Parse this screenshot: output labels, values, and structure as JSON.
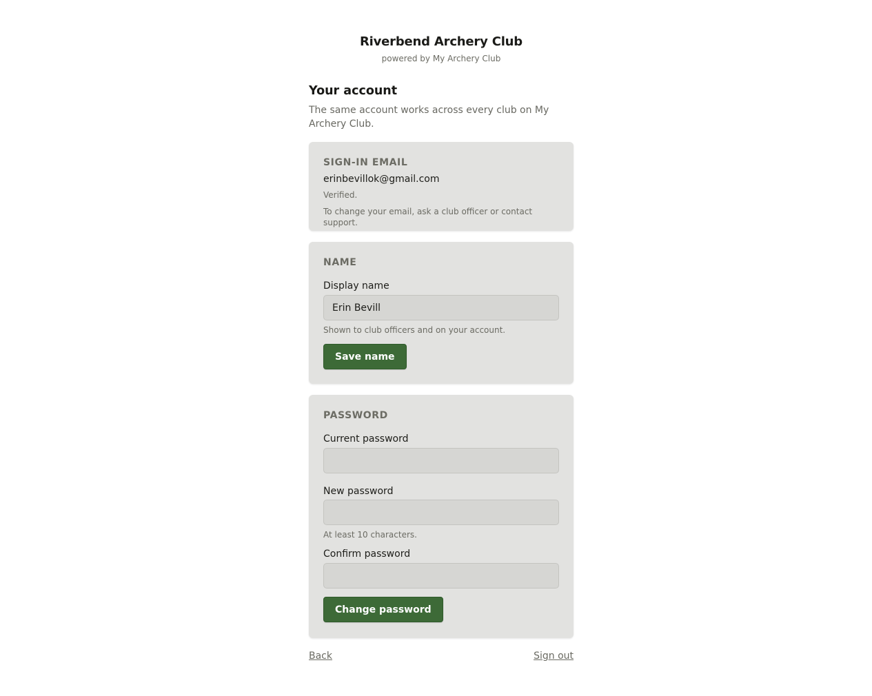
{
  "header": {
    "club_name": "Riverbend Archery Club",
    "powered_by": "powered by My Archery Club"
  },
  "page": {
    "title": "Your account",
    "intro": "The same account works across every club on My Archery Club."
  },
  "email_card": {
    "title": "SIGN-IN EMAIL",
    "email": "erinbevillok@gmail.com",
    "status": "Verified.",
    "help": "To change your email, ask a club officer or contact support."
  },
  "name_card": {
    "title": "NAME",
    "label": "Display name",
    "value": "Erin Bevill",
    "help": "Shown to club officers and on your account.",
    "button": "Save name"
  },
  "password_card": {
    "title": "PASSWORD",
    "current_label": "Current password",
    "current_value": "",
    "new_label": "New password",
    "new_value": "",
    "new_help": "At least 10 characters.",
    "confirm_label": "Confirm password",
    "confirm_value": "",
    "button": "Change password"
  },
  "footer": {
    "back": "Back",
    "sign_out": "Sign out"
  },
  "colors": {
    "accent": "#3d6a37",
    "card_bg": "#e2e2e0",
    "input_bg": "#d6d6d3"
  }
}
